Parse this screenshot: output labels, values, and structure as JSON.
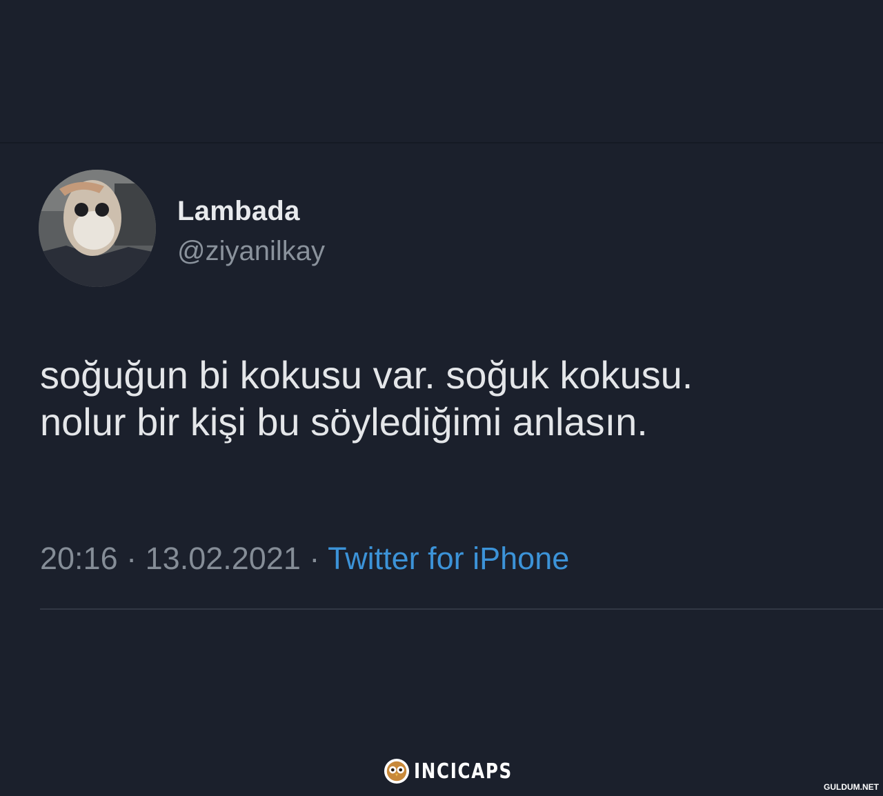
{
  "tweet": {
    "display_name": "Lambada",
    "handle": "@ziyanilkay",
    "text_lines": [
      "soğuğun bi kokusu var. soğuk kokusu.",
      "nolur bir kişi bu söylediğimi anlasın."
    ],
    "time": "20:16",
    "date": "13.02.2021",
    "separator": "·",
    "source": "Twitter for iPhone"
  },
  "watermark": {
    "brand": "INCICAPS",
    "icon": "owl-icon"
  },
  "corner_watermark": "GULDUM.NET",
  "colors": {
    "background": "#1b202c",
    "text_primary": "#e4e6e9",
    "text_secondary": "#858d97",
    "link": "#3c93d8"
  }
}
